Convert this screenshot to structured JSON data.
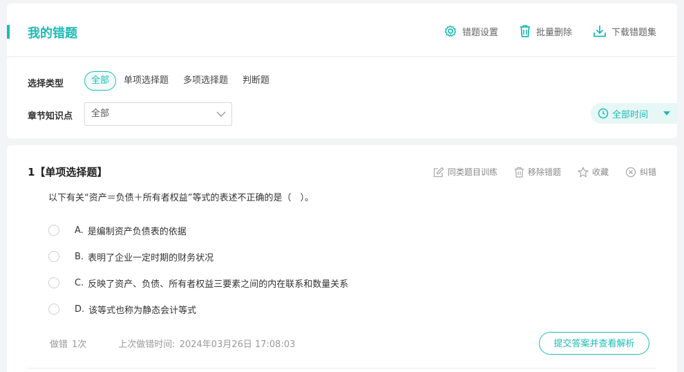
{
  "header": {
    "title": "我的错题",
    "actions": [
      {
        "label": "错题设置",
        "icon": "gear-icon"
      },
      {
        "label": "批量删除",
        "icon": "trash-icon"
      },
      {
        "label": "下载错题集",
        "icon": "download-icon"
      }
    ]
  },
  "filters": {
    "type_label": "选择类型",
    "types": [
      "全部",
      "单项选择题",
      "多项选择题",
      "判断题"
    ],
    "active_type": "全部",
    "chapter_label": "章节知识点",
    "chapter_value": "全部",
    "time_filter": "全部时间"
  },
  "question": {
    "title": "1【单项选择题】",
    "actions": [
      {
        "label": "同类题目训练",
        "icon": "edit-icon"
      },
      {
        "label": "移除错题",
        "icon": "trash-icon"
      },
      {
        "label": "收藏",
        "icon": "star-icon"
      },
      {
        "label": "纠错",
        "icon": "error-icon"
      }
    ],
    "stem": "以下有关“资产＝负债＋所有者权益”等式的表述不正确的是（　）。",
    "options": [
      {
        "letter": "A.",
        "text": "是编制资产负债表的依据"
      },
      {
        "letter": "B.",
        "text": "表明了企业一定时期的财务状况"
      },
      {
        "letter": "C.",
        "text": "反映了资产、负债、所有者权益三要素之间的内在联系和数量关系"
      },
      {
        "letter": "D.",
        "text": "该等式也称为静态会计等式"
      }
    ],
    "wrong_label": "做错",
    "wrong_count": "1次",
    "last_wrong_label": "上次做错时间:",
    "last_wrong_time": "2024年03月26日 17:08:03",
    "submit_label": "提交答案并查看解析"
  },
  "colors": {
    "accent": "#1cbbb4",
    "muted": "#999999"
  }
}
